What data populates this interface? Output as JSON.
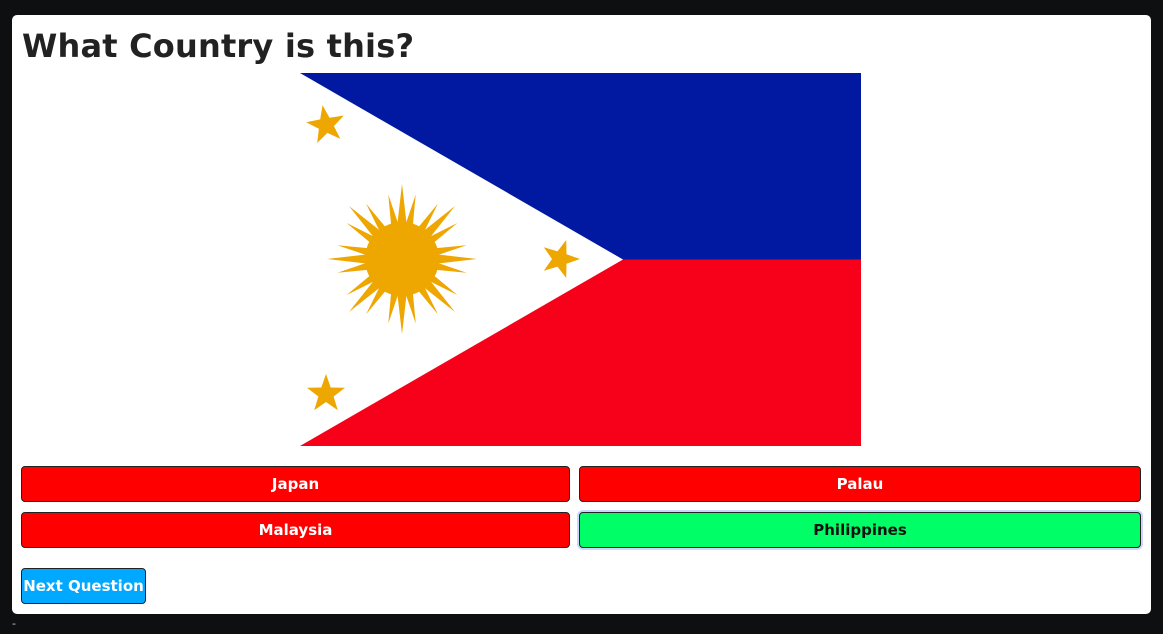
{
  "quiz": {
    "question": "What Country is this?",
    "flag_icon": "philippines-flag",
    "answers": [
      {
        "label": "Japan",
        "state": "incorrect"
      },
      {
        "label": "Palau",
        "state": "incorrect"
      },
      {
        "label": "Malaysia",
        "state": "incorrect"
      },
      {
        "label": "Philippines",
        "state": "correct"
      }
    ],
    "next_label": "Next Question"
  },
  "footer": {
    "dash": "-"
  },
  "colors": {
    "background": "#0d0f11",
    "card": "#ffffff",
    "incorrect": "#ff0000",
    "correct": "#00ff66",
    "next_button": "#00a8ff",
    "flag_blue": "#0019a0",
    "flag_red": "#f70019",
    "flag_gold": "#eea600"
  }
}
